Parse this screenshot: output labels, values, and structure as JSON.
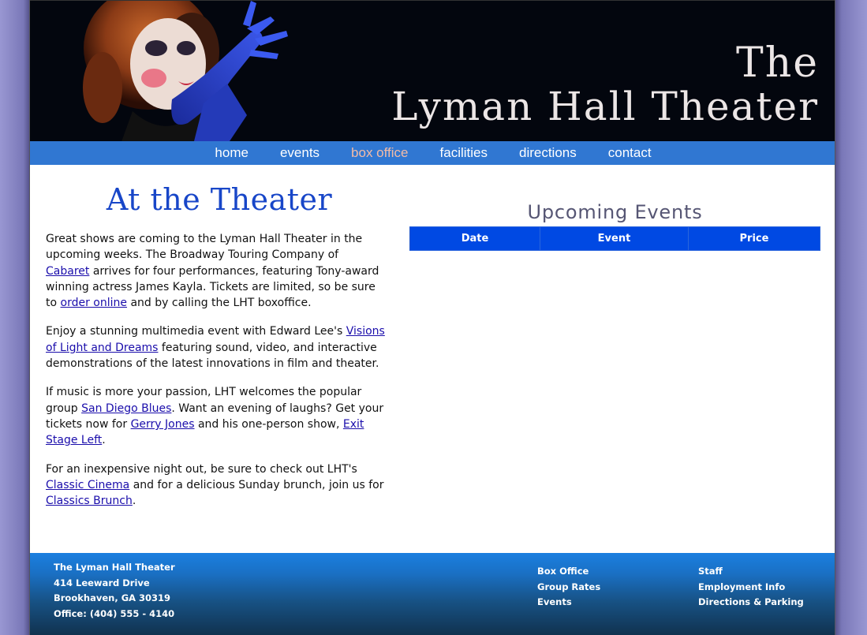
{
  "header": {
    "title_the": "The",
    "title_name": "Lyman Hall Theater"
  },
  "nav": {
    "items": [
      {
        "label": "home"
      },
      {
        "label": "events"
      },
      {
        "label": "box office"
      },
      {
        "label": "facilities"
      },
      {
        "label": "directions"
      },
      {
        "label": "contact"
      }
    ],
    "active": "box office",
    "active_color": "#f2bba7"
  },
  "main": {
    "heading": "At the Theater",
    "p1": {
      "t1": "Great shows are coming to the Lyman Hall Theater in the upcoming weeks. The Broadway Touring Company of ",
      "link1": "Cabaret",
      "t2": " arrives for four performances, featuring Tony-award winning actress James Kayla. Tickets are limited, so be sure to ",
      "link2": "order online",
      "t3": " and by calling the LHT boxoffice."
    },
    "p2": {
      "t1": "Enjoy a stunning multimedia event with Edward Lee's ",
      "link1": "Visions of Light and Dreams",
      "t2": " featuring sound, video, and interactive demonstrations of the latest innovations in film and theater."
    },
    "p3": {
      "t1": "If music is more your passion, LHT welcomes the popular group ",
      "link1": "San Diego Blues",
      "t2": ". Want an evening of laughs? Get your tickets now for ",
      "link2": "Gerry Jones",
      "t3": " and his one-person show, ",
      "link3": "Exit Stage Left",
      "t4": "."
    },
    "p4": {
      "t1": "For an inexpensive night out, be sure to check out LHT's ",
      "link1": "Classic Cinema",
      "t2": " and for a delicious Sunday brunch, join us for ",
      "link2": "Classics Brunch",
      "t3": "."
    }
  },
  "events": {
    "heading": "Upcoming Events",
    "columns": [
      "Date",
      "Event",
      "Price"
    ]
  },
  "footer": {
    "address": [
      "The Lyman Hall Theater",
      "414 Leeward Drive",
      "Brookhaven, GA 30319",
      "Office: (404) 555 - 4140"
    ],
    "links_col1": [
      "Box Office",
      "Group Rates",
      "Events"
    ],
    "links_col2": [
      "Staff",
      "Employment Info",
      "Directions & Parking"
    ]
  },
  "colors": {
    "nav_bar": "#3077d2",
    "heading_blue": "#1846c8",
    "table_header": "#0049e3",
    "link": "#1a0dab"
  },
  "icons": [
    "header-portrait-image"
  ]
}
